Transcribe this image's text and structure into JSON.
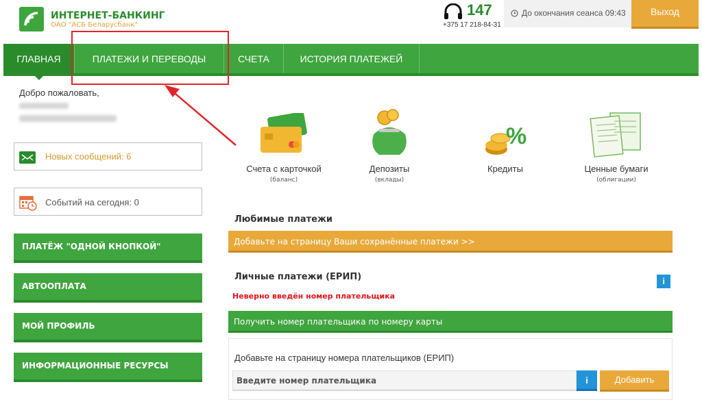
{
  "header": {
    "brand_title": "ИНТЕРНЕТ-БАНКИНГ",
    "brand_subtitle": "ОАО \"АСБ Беларусбанк\"",
    "phone_short": "147",
    "phone_full": "+375 17 218-84-31",
    "session_text": "До окончания сеанса 09:43",
    "logout_label": "Выход"
  },
  "nav": {
    "items": [
      {
        "label": "ГЛАВНАЯ",
        "active": true
      },
      {
        "label": "ПЛАТЕЖИ И ПЕРЕВОДЫ"
      },
      {
        "label": "СЧЕТА"
      },
      {
        "label": "ИСТОРИЯ ПЛАТЕЖЕЙ"
      }
    ]
  },
  "sidebar": {
    "welcome": "Добро пожаловать,",
    "messages": "Новых сообщений: 6",
    "events": "Событий на сегодня: 0",
    "buttons": [
      {
        "label": "ПЛАТЁЖ \"ОДНОЙ КНОПКОЙ\""
      },
      {
        "label": "АВТООПЛАТА"
      },
      {
        "label": "МОЙ ПРОФИЛЬ"
      },
      {
        "label": "ИНФОРМАЦИОННЫЕ РЕСУРСЫ"
      }
    ]
  },
  "tiles": [
    {
      "label": "Счета с карточкой",
      "sub": "(баланс)",
      "icon": "cards-icon"
    },
    {
      "label": "Депозиты",
      "sub": "(вклады)",
      "icon": "money-bag-icon"
    },
    {
      "label": "Кредиты",
      "sub": "",
      "icon": "coins-percent-icon"
    },
    {
      "label": "Ценные бумаги",
      "sub": "(облигации)",
      "icon": "bonds-icon"
    }
  ],
  "favorites": {
    "title": "Любимые платежи",
    "add_link": "Добавьте на страницу Ваши сохранённые платежи >>"
  },
  "erip": {
    "title": "Личные платежи (ЕРИП)",
    "info": "i",
    "error": "Неверно введён номер плательщика",
    "card_lookup": "Получить номер плательщика по номеру карты",
    "panel_title": "Добавьте на страницу номера плательщиков (ЕРИП)",
    "input_placeholder": "Введите номер плательщика",
    "add_button": "Добавить"
  },
  "colors": {
    "brand_green": "#3fa53e",
    "dark_green": "#2a8b2b",
    "accent_orange": "#e8a93a",
    "error_red": "#e0141b",
    "info_blue": "#2394d8",
    "annotation_red": "#e0262a"
  }
}
